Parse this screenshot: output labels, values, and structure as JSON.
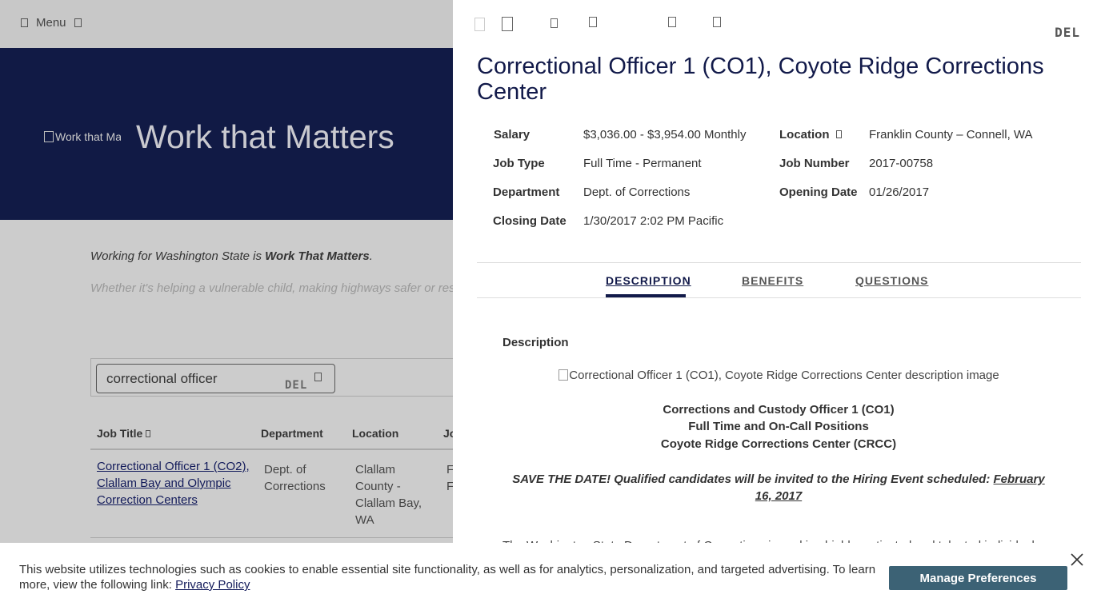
{
  "background": {
    "menu_label": "Menu",
    "hero_image_alt": "Work that Matters",
    "hero_title": "Work that Matters",
    "intro_prefix": "Working for Washington State is ",
    "intro_bold": "Work That Matters",
    "intro_suffix": ".",
    "intro_line2": "Whether it's helping a vulnerable child, making highways safer or res",
    "search": {
      "value": "correctional officer",
      "clear_label": "DEL"
    },
    "table": {
      "headers": [
        "Job Title",
        "Department",
        "Location",
        "Jo"
      ],
      "rows": [
        {
          "title": "Correctional Officer 1 (CO2), Clallam Bay and Olympic Correction Centers",
          "department": "Dept. of Corrections",
          "location": "Clallam County - Clallam Bay, WA",
          "cut": "F F"
        }
      ]
    }
  },
  "panel": {
    "close_label": "DEL",
    "title": "Correctional Officer 1 (CO1), Coyote Ridge Corrections Center",
    "meta_left": [
      {
        "label": "Salary",
        "value": "$3,036.00 - $3,954.00 Monthly"
      },
      {
        "label": "Job Type",
        "value": "Full Time - Permanent"
      },
      {
        "label": "Department",
        "value": "Dept. of Corrections"
      },
      {
        "label": "Closing Date",
        "value": "1/30/2017 2:02 PM Pacific"
      }
    ],
    "meta_right": [
      {
        "label": "Location",
        "value": "Franklin County – Connell, WA"
      },
      {
        "label": "Job Number",
        "value": "2017-00758"
      },
      {
        "label": "Opening Date",
        "value": "01/26/2017"
      }
    ],
    "tabs": [
      "DESCRIPTION",
      "BENEFITS",
      "QUESTIONS"
    ],
    "active_tab": "DESCRIPTION",
    "description": {
      "heading": "Description",
      "image_alt": "Correctional Officer 1 (CO1), Coyote Ridge Corrections Center description image",
      "line1": "Corrections and Custody Officer 1 (CO1)",
      "line2": "Full Time and On-Call Positions",
      "line3": "Coyote Ridge Corrections Center (CRCC)",
      "save_prefix": "SAVE THE DATE!  Qualified candidates will be invited to the Hiring Event scheduled: ",
      "save_link": "February 16, 2017",
      "cut_line": "The Washington State Department of Corrections is seeking highly motivated and talented individuals"
    }
  },
  "cookie": {
    "text": "This website utilizes technologies such as cookies to enable essential site functionality, as well as for analytics, personalization, and targeted advertising. To learn more, view the following link: ",
    "link": "Privacy Policy",
    "button": "Manage Preferences"
  },
  "colors": {
    "navy": "#121a4a",
    "hero_bg": "#111a45",
    "button_bg": "#3c6275",
    "overlay_gray": "#cccccc"
  }
}
